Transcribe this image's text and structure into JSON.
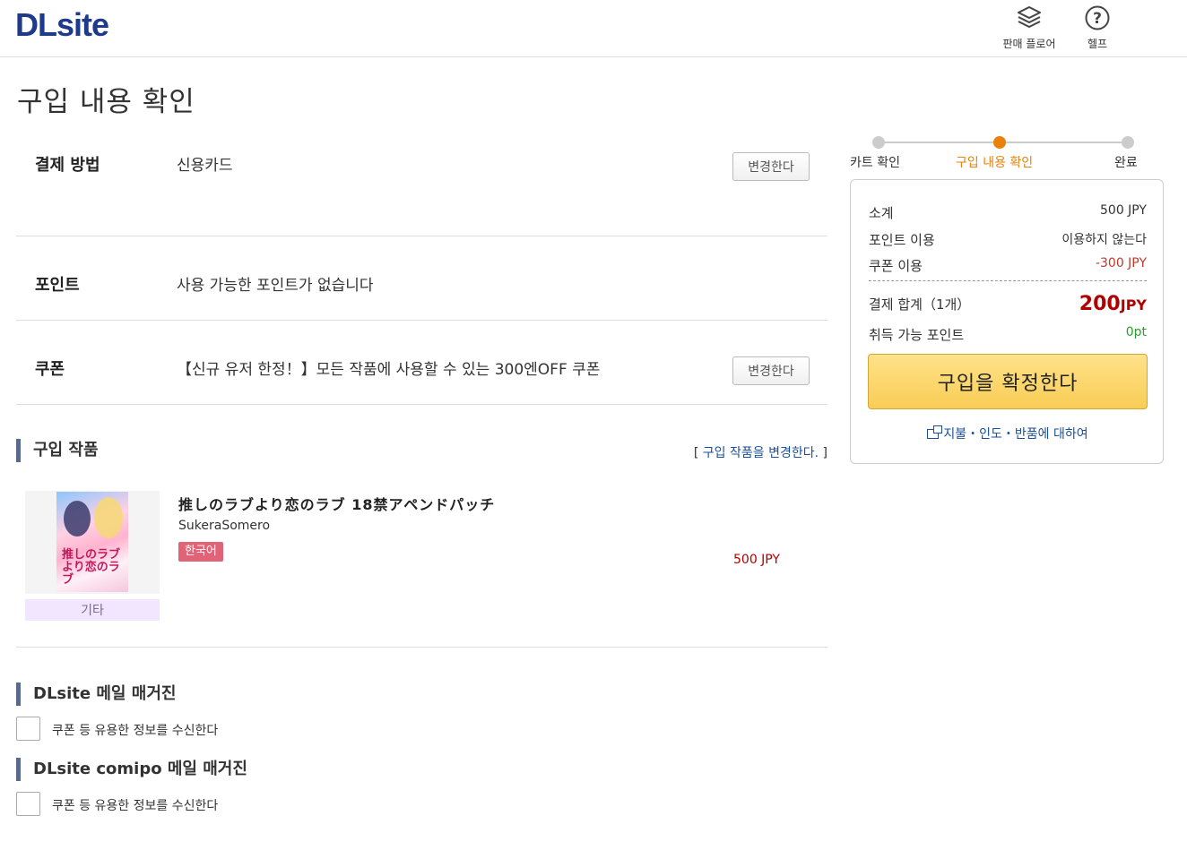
{
  "header": {
    "logo_dl": "DL",
    "logo_site": "site",
    "sell_floor_label": "판매 플로어",
    "help_label": "헬프"
  },
  "page_title": "구입 내용 확인",
  "payment": {
    "label": "결제 방법",
    "value": "신용카드",
    "change_label": "변경한다"
  },
  "points": {
    "label": "포인트",
    "value": "사용 가능한 포인트가 없습니다"
  },
  "coupon": {
    "label": "쿠폰",
    "value": "【신규 유저 한정！】모든 작품에 사용할 수 있는 300엔OFF 쿠폰",
    "change_label": "변경한다"
  },
  "works_section": {
    "heading": "구입 작품",
    "change_link": "구입 작품을 변경한다.",
    "items": [
      {
        "title": "推しのラブより恋のラブ 18禁アペンドパッチ",
        "circle": "SukeraSomero",
        "language_badge": "한국어",
        "price": "500 JPY",
        "category": "기타",
        "thumb_text": "推しのラブより恋のラブ"
      }
    ]
  },
  "newsletters": [
    {
      "heading": "DLsite 메일 매거진",
      "checkbox_label": "쿠폰 등 유용한 정보를 수신한다"
    },
    {
      "heading": "DLsite comipo 메일 매거진",
      "checkbox_label": "쿠폰 등 유용한 정보를 수신한다"
    }
  ],
  "steps": [
    {
      "label": "카트 확인",
      "active": false
    },
    {
      "label": "구입 내용 확인",
      "active": true
    },
    {
      "label": "완료",
      "active": false
    }
  ],
  "summary": {
    "subtotal_label": "소계",
    "subtotal_value": "500 JPY",
    "point_use_label": "포인트 이용",
    "point_use_value": "이용하지 않는다",
    "coupon_use_label": "쿠폰 이용",
    "coupon_use_value": "-300 JPY",
    "total_label": "결제 합계（1개）",
    "total_amount": "200",
    "total_currency": "JPY",
    "earn_points_label": "취득 가능 포인트",
    "earn_points_value": "0pt",
    "buy_button_label": "구입을 확정한다",
    "policy_link": "지불・인도・반품에 대하여"
  },
  "colors": {
    "brand": "#1e3a8a",
    "accent_step": "#e8820c",
    "price_red": "#b00000",
    "points_green": "#2e9b2e",
    "buy_button": "#f9cd55",
    "lang_badge": "#e06377"
  }
}
